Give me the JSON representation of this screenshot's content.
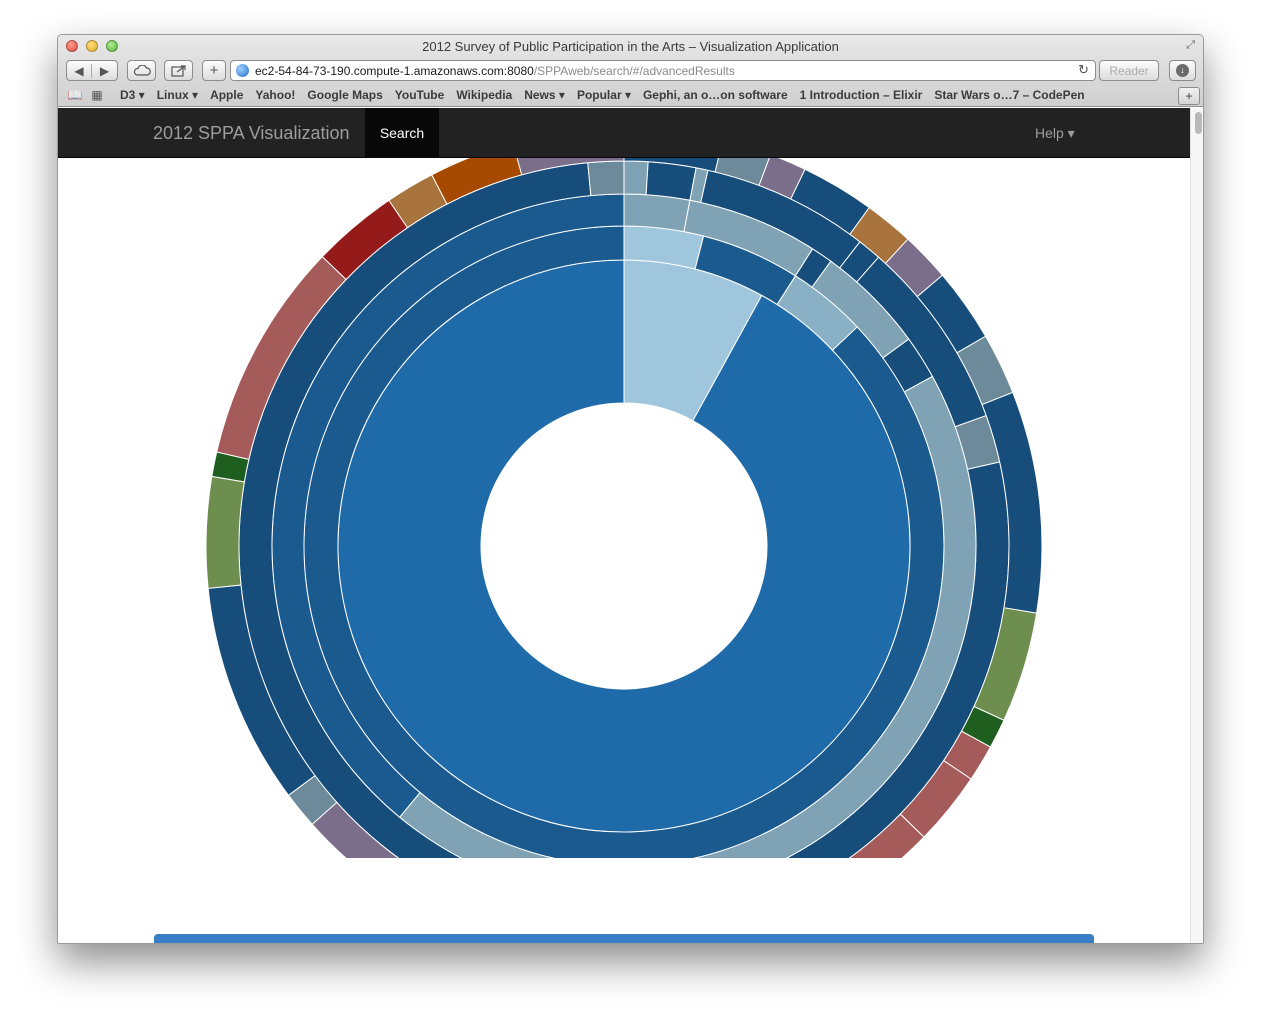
{
  "window": {
    "title": "2012 Survey of Public Participation in the Arts – Visualization Application"
  },
  "toolbar": {
    "back_glyph": "◀",
    "forward_glyph": "▶",
    "add_tab_glyph": "+",
    "reload_glyph": "↻",
    "reader_label": "Reader",
    "download_glyph": "↓",
    "url_host": "ec2-54-84-73-190.compute-1.amazonaws.com:8080",
    "url_path": "/SPPAweb/search/#/advancedResults"
  },
  "bookmarks": {
    "items": [
      "D3 ▾",
      "Linux ▾",
      "Apple",
      "Yahoo!",
      "Google Maps",
      "YouTube",
      "Wikipedia",
      "News ▾",
      "Popular ▾",
      "Gephi, an o…on software",
      "1 Introduction – Elixir",
      "Star Wars o…7 – CodePen"
    ],
    "new_tab_glyph": "+"
  },
  "navbar": {
    "brand": "2012 SPPA Visualization",
    "search": "Search",
    "help": "Help ▾"
  },
  "colors": {
    "navbar_bg": "#222222",
    "ring1_blue": "#1f6aa8",
    "ring1_light": "#9fc6dc",
    "ring2_blue": "#1b5a8e",
    "ring3_gray": "#7fa3b5",
    "ring4_dark": "#174d7a",
    "teal_gray": "#6d8a9a",
    "purple": "#7b6e8a",
    "orange": "#a64a00",
    "tan": "#a8733d",
    "salmon": "#a65b5b",
    "crimson": "#951a1a",
    "olive": "#6e8e4f",
    "dark_green": "#1e5e1e",
    "bottom_bar": "#3a7ec6"
  },
  "chart_data": {
    "type": "sunburst",
    "rings": [
      {
        "level": 1,
        "segments": [
          {
            "share": 0.08,
            "color": "#9fc6dc"
          },
          {
            "share": 0.92,
            "color": "#1f6aa8"
          }
        ]
      },
      {
        "level": 2,
        "segments": [
          {
            "share": 0.04,
            "color": "#9fc6dc"
          },
          {
            "share": 0.05,
            "color": "#1b5a8e"
          },
          {
            "share": 0.04,
            "color": "#8ab0c5"
          },
          {
            "share": 0.87,
            "color": "#1b5a8e"
          }
        ]
      },
      {
        "level": 3,
        "segments": [
          {
            "share": 0.03,
            "color": "#7fa3b5"
          },
          {
            "share": 0.06,
            "color": "#7fa3b5"
          },
          {
            "share": 0.01,
            "color": "#174d7a"
          },
          {
            "share": 0.05,
            "color": "#7fa3b5"
          },
          {
            "share": 0.02,
            "color": "#174d7a"
          },
          {
            "share": 0.44,
            "color": "#7fa3b5"
          },
          {
            "share": 0.39,
            "color": "#1b5a8e"
          }
        ]
      },
      {
        "level": 4,
        "segments": [
          {
            "share": 0.01,
            "color": "#7fa3b5"
          },
          {
            "share": 0.02,
            "color": "#174d7a"
          },
          {
            "share": 0.005,
            "color": "#7fa3b5"
          },
          {
            "share": 0.07,
            "color": "#174d7a"
          },
          {
            "share": 0.01,
            "color": "#174d7a"
          },
          {
            "share": 0.08,
            "color": "#174d7a"
          },
          {
            "share": 0.02,
            "color": "#6d8a9a"
          },
          {
            "share": 0.77,
            "color": "#174d7a"
          },
          {
            "share": 0.015,
            "color": "#6d8a9a"
          }
        ]
      }
    ],
    "outer_ring_blocks": [
      {
        "share": 0.04,
        "color": "#174d7a"
      },
      {
        "share": 0.02,
        "color": "#6d8a9a"
      },
      {
        "share": 0.015,
        "color": "#7b6e8a"
      },
      {
        "share": 0.03,
        "color": "#174d7a"
      },
      {
        "share": 0.02,
        "color": "#a8733d"
      },
      {
        "share": 0.02,
        "color": "#7b6e8a"
      },
      {
        "share": 0.03,
        "color": "#174d7a"
      },
      {
        "share": 0.025,
        "color": "#6d8a9a"
      },
      {
        "share": 0.09,
        "color": "#174d7a"
      },
      {
        "share": 0.045,
        "color": "#6e8e4f"
      },
      {
        "share": 0.012,
        "color": "#1e5e1e"
      },
      {
        "share": 0.015,
        "color": "#a65b5b"
      },
      {
        "share": 0.03,
        "color": "#a65b5b"
      },
      {
        "share": 0.05,
        "color": "#a65b5b"
      },
      {
        "share": 0.02,
        "color": "#951a1a"
      },
      {
        "share": 0.03,
        "color": "#951a1a"
      },
      {
        "share": 0.02,
        "color": "#951a1a"
      },
      {
        "share": 0.035,
        "color": "#a8733d"
      },
      {
        "share": 0.005,
        "color": "#a8733d"
      },
      {
        "share": 0.04,
        "color": "#a64a00"
      },
      {
        "share": 0.015,
        "color": "#a64a00"
      },
      {
        "share": 0.005,
        "color": "#a64a00"
      },
      {
        "share": 0.055,
        "color": "#7b6e8a"
      },
      {
        "share": 0.015,
        "color": "#6d8a9a"
      },
      {
        "share": 0.09,
        "color": "#174d7a"
      },
      {
        "share": 0.045,
        "color": "#6e8e4f"
      },
      {
        "share": 0.01,
        "color": "#1e5e1e"
      },
      {
        "share": 0.09,
        "color": "#a65b5b"
      },
      {
        "share": 0.035,
        "color": "#951a1a"
      },
      {
        "share": 0.02,
        "color": "#a8733d"
      },
      {
        "share": 0.035,
        "color": "#a64a00"
      },
      {
        "share": 0.045,
        "color": "#7b6e8a"
      }
    ]
  }
}
